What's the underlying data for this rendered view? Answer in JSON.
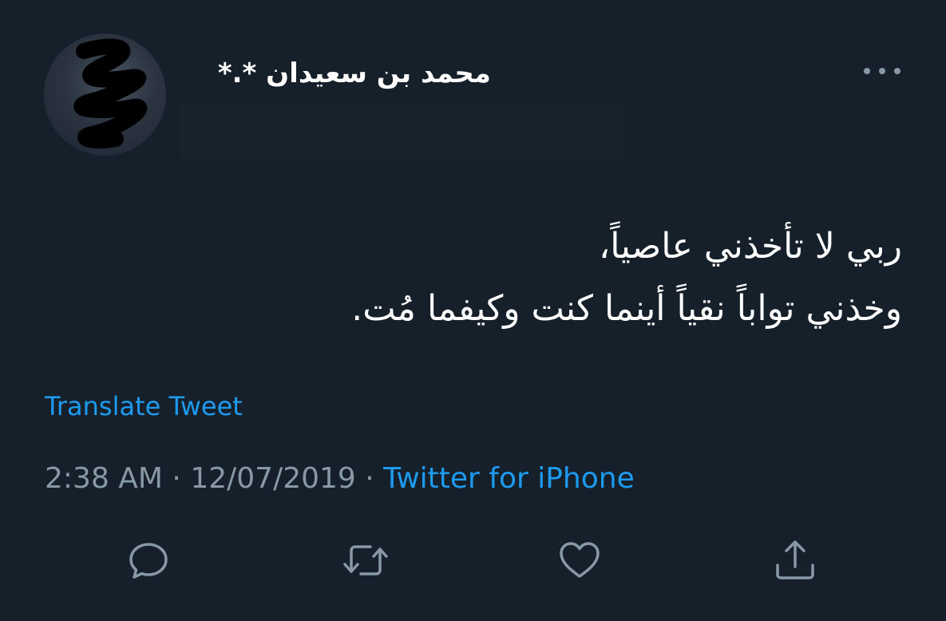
{
  "user": {
    "display_name": "محمد بن سعيدان *.*"
  },
  "tweet": {
    "text": "ربي لا تأخذني عاصياً،\nوخذني تواباً نقياً أينما كنت وكيفما مُت."
  },
  "translate_label": "Translate Tweet",
  "meta": {
    "time": "2:38 AM",
    "separator": " · ",
    "date": "12/07/2019",
    "source": "Twitter for iPhone"
  },
  "actions": [
    {
      "icon": "reply-icon"
    },
    {
      "icon": "retweet-icon"
    },
    {
      "icon": "like-icon"
    },
    {
      "icon": "share-icon"
    }
  ],
  "colors": {
    "background": "#15202b",
    "accent": "#1d9bf0",
    "secondary_text": "#8899a6"
  }
}
